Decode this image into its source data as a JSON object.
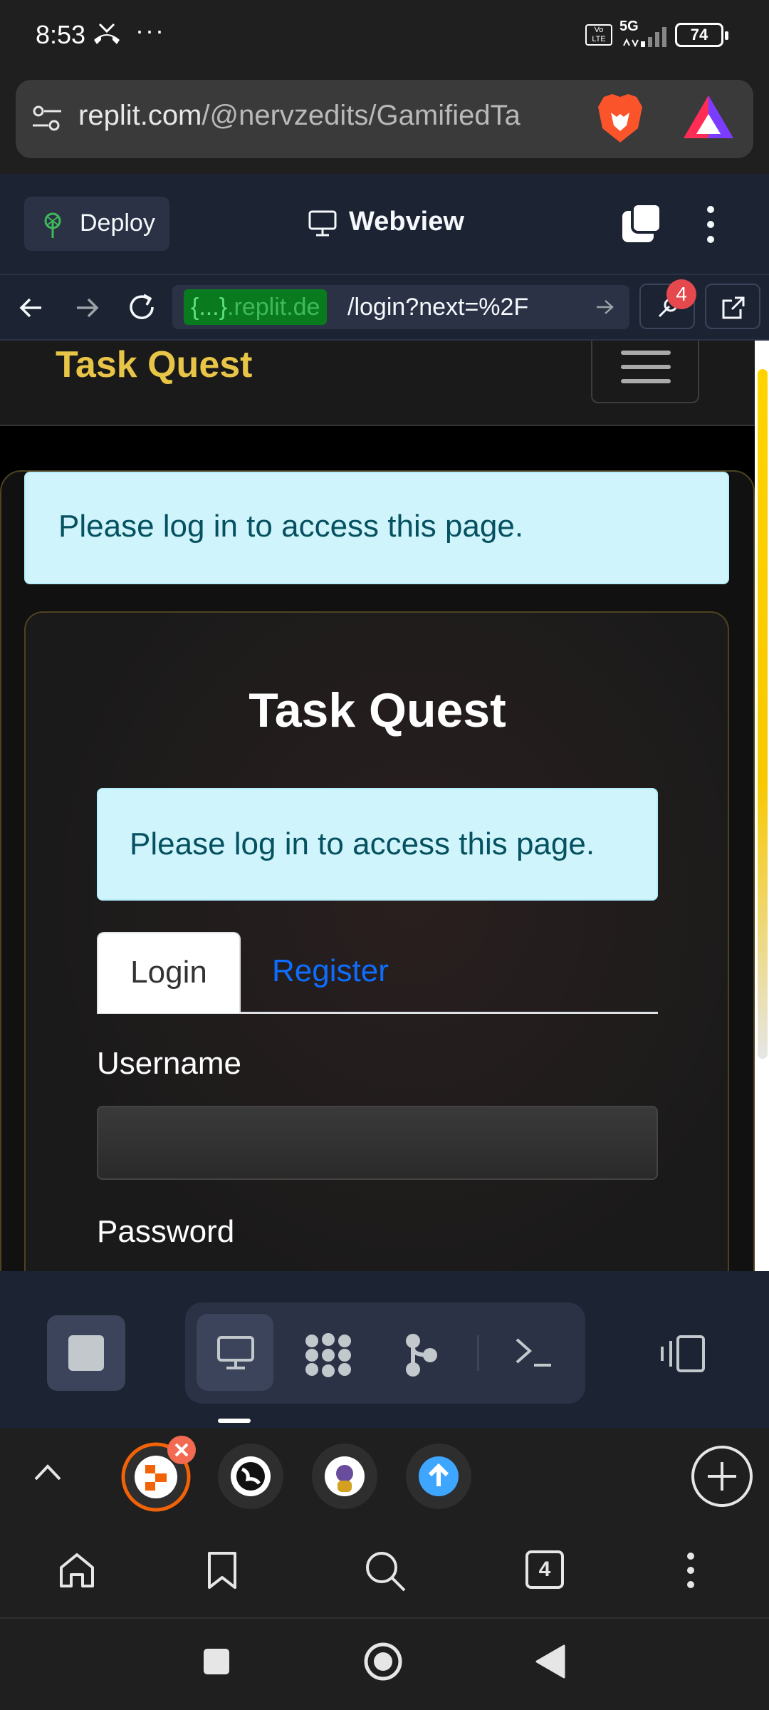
{
  "status_bar": {
    "time": "8:53",
    "overflow": "···",
    "network": "5G",
    "volte": "Vo LTE",
    "battery": "74"
  },
  "browser": {
    "url_host": "replit.com",
    "url_path": "/@nervzedits/GamifiedTa",
    "icons": [
      "filter-icon",
      "brave-lion-icon",
      "brave-rewards-icon"
    ]
  },
  "replit": {
    "deploy_label": "Deploy",
    "webview_label": "Webview",
    "address": {
      "host_badge": "{...}",
      "host_rest": ".replit.de",
      "path": "/login?next=%2F"
    },
    "tools_badge": "4"
  },
  "site": {
    "brand": "Task Quest",
    "alert_top": "Please log in to access this page.",
    "card_title": "Task Quest",
    "alert_card": "Please log in to access this page.",
    "tabs": [
      {
        "label": "Login",
        "active": true
      },
      {
        "label": "Register",
        "active": false
      }
    ],
    "username_label": "Username",
    "password_label": "Password",
    "username_value": "",
    "colors": {
      "brand": "#e8c547",
      "alert_bg": "#cff4fc",
      "alert_text": "#055160",
      "link": "#0d6efd"
    }
  },
  "brave_bottom": {
    "tab_count": "4"
  }
}
